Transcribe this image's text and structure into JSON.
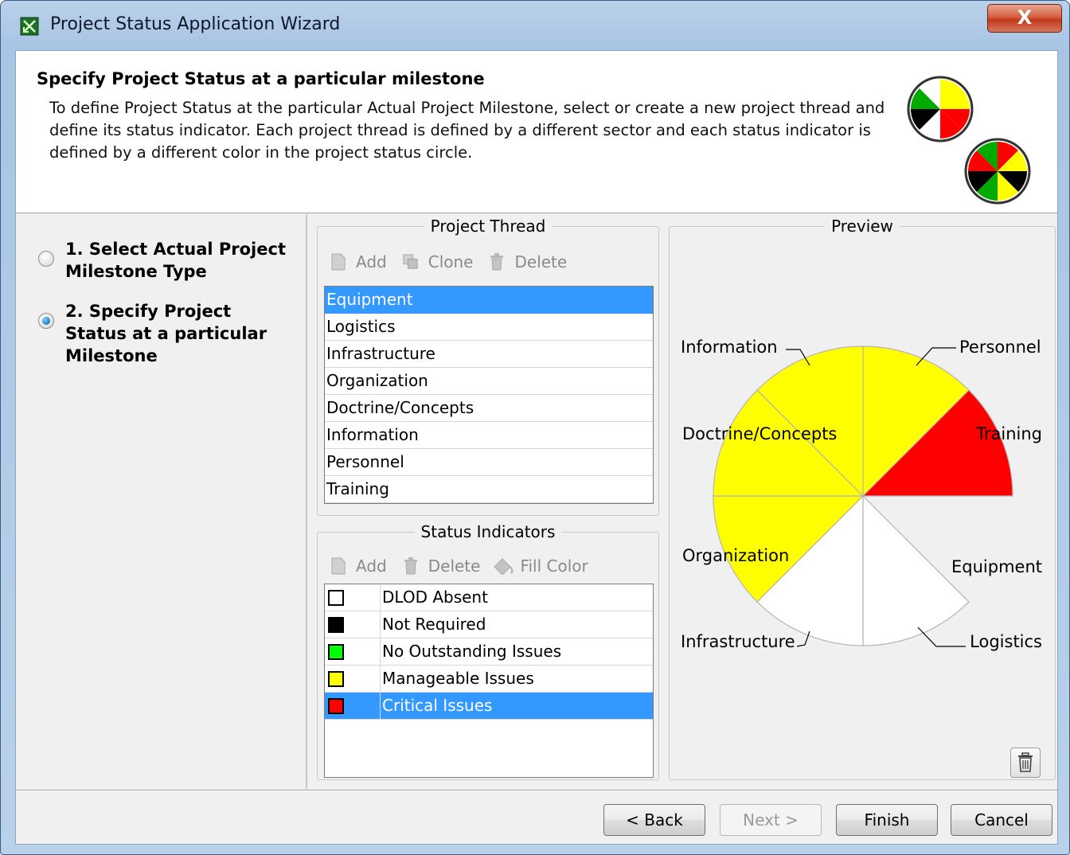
{
  "window": {
    "title": "Project Status Application Wizard",
    "close_label": "X"
  },
  "header": {
    "title": "Specify Project Status at a particular milestone",
    "description": "To define Project Status at the particular Actual Project Milestone, select or create a new project thread and define its status indicator. Each project thread is defined by a different sector and each status indicator is defined by a different color in the project status circle."
  },
  "steps": [
    {
      "label": "1. Select Actual Project Milestone Type",
      "checked": false
    },
    {
      "label": "2. Specify Project Status at a particular Milestone",
      "checked": true
    }
  ],
  "project_thread": {
    "group_title": "Project Thread",
    "toolbar": {
      "add": "Add",
      "clone": "Clone",
      "delete": "Delete"
    },
    "items": [
      "Equipment",
      "Logistics",
      "Infrastructure",
      "Organization",
      "Doctrine/Concepts",
      "Information",
      "Personnel",
      "Training"
    ],
    "selected": "Equipment"
  },
  "status_indicators": {
    "group_title": "Status Indicators",
    "toolbar": {
      "add": "Add",
      "delete": "Delete",
      "fill_color": "Fill Color"
    },
    "items": [
      {
        "label": "DLOD Absent",
        "color": "#ffffff"
      },
      {
        "label": "Not Required",
        "color": "#000000"
      },
      {
        "label": "No Outstanding Issues",
        "color": "#00ff00"
      },
      {
        "label": "Manageable Issues",
        "color": "#ffff00"
      },
      {
        "label": "Critical Issues",
        "color": "#ff0000"
      }
    ],
    "selected": "Critical Issues"
  },
  "preview": {
    "group_title": "Preview",
    "sectors": [
      {
        "label": "Personnel",
        "color": "#ffff00",
        "exploded": false
      },
      {
        "label": "Training",
        "color": "#ff0000",
        "exploded": false
      },
      {
        "label": "Equipment",
        "color": "#ff0000",
        "exploded": true
      },
      {
        "label": "Logistics",
        "color": "#ffffff",
        "exploded": false
      },
      {
        "label": "Infrastructure",
        "color": "#ffffff",
        "exploded": false
      },
      {
        "label": "Organization",
        "color": "#ffff00",
        "exploded": false
      },
      {
        "label": "Doctrine/Concepts",
        "color": "#ffff00",
        "exploded": false
      },
      {
        "label": "Information",
        "color": "#ffff00",
        "exploded": false
      }
    ]
  },
  "footer": {
    "back": "< Back",
    "next": "Next >",
    "finish": "Finish",
    "cancel": "Cancel"
  }
}
